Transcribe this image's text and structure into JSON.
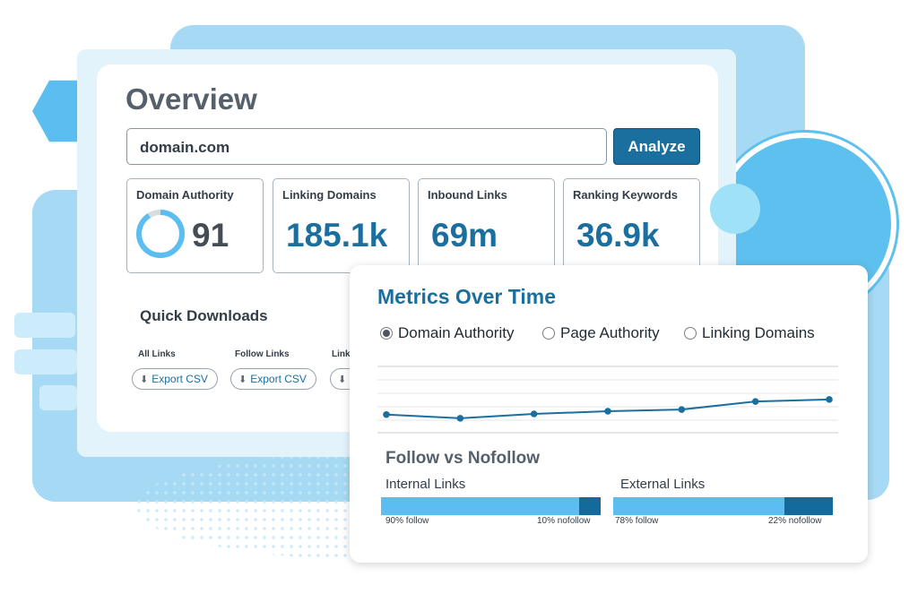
{
  "overview": {
    "title": "Overview",
    "search_value": "domain.com",
    "analyze_label": "Analyze",
    "metrics": [
      {
        "label": "Domain Authority",
        "value": "91",
        "ring_fill": 0.91
      },
      {
        "label": "Linking Domains",
        "value": "185.1k"
      },
      {
        "label": "Inbound Links",
        "value": "69m"
      },
      {
        "label": "Ranking Keywords",
        "value": "36.9k"
      }
    ],
    "quick_downloads": {
      "title": "Quick Downloads",
      "items": [
        {
          "label": "All Links",
          "button": "Export CSV"
        },
        {
          "label": "Follow Links",
          "button": "Export CSV"
        },
        {
          "label": "Link",
          "button": ""
        }
      ]
    }
  },
  "metrics_over_time": {
    "title": "Metrics Over Time",
    "options": [
      {
        "label": "Domain Authority",
        "checked": true
      },
      {
        "label": "Page Authority",
        "checked": false
      },
      {
        "label": "Linking Domains",
        "checked": false
      }
    ]
  },
  "chart_data": {
    "type": "line",
    "title": "",
    "xlabel": "",
    "ylabel": "",
    "x": [
      1,
      2,
      3,
      4,
      5,
      6,
      7
    ],
    "series": [
      {
        "values": [
          0.38,
          0.27,
          0.4,
          0.48,
          0.53,
          0.77,
          0.83
        ]
      }
    ],
    "ylim": [
      0,
      2
    ],
    "grid": true
  },
  "follow_vs_nofollow": {
    "title": "Follow vs Nofollow",
    "internal": {
      "label": "Internal Links",
      "follow_pct": 90,
      "follow_text": "90% follow",
      "nofollow_text": "10% nofollow"
    },
    "external": {
      "label": "External Links",
      "follow_pct": 78,
      "follow_text": "78% follow",
      "nofollow_text": "22% nofollow"
    }
  },
  "colors": {
    "primary": "#1a6f9f",
    "light": "#5cbef0",
    "background": "#a6daf4"
  },
  "icons": {
    "download": "download-icon"
  }
}
